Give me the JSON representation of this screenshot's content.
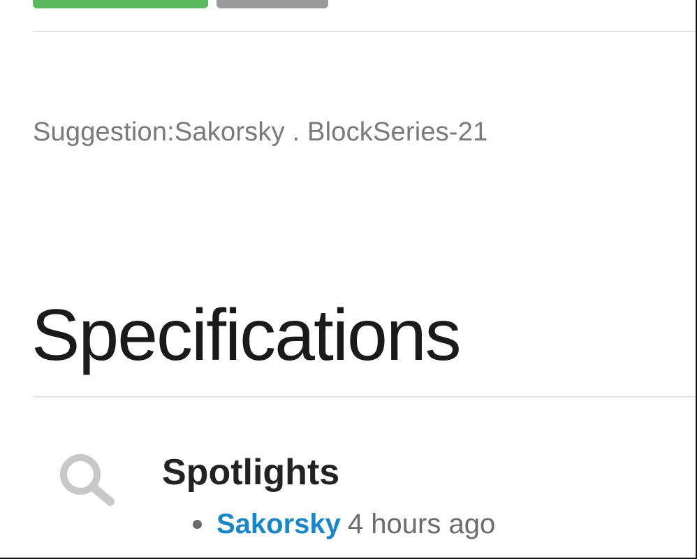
{
  "suggestion": {
    "text": "Suggestion:Sakorsky . BlockSeries-21"
  },
  "section": {
    "title": "Specifications"
  },
  "spotlights": {
    "title": "Spotlights",
    "icon": "search-icon",
    "items": [
      {
        "user": "Sakorsky",
        "time": "4 hours ago"
      }
    ]
  },
  "colors": {
    "primary_button": "#5cb85c",
    "secondary_button": "#9a9a9a",
    "link": "#1a86c7"
  }
}
